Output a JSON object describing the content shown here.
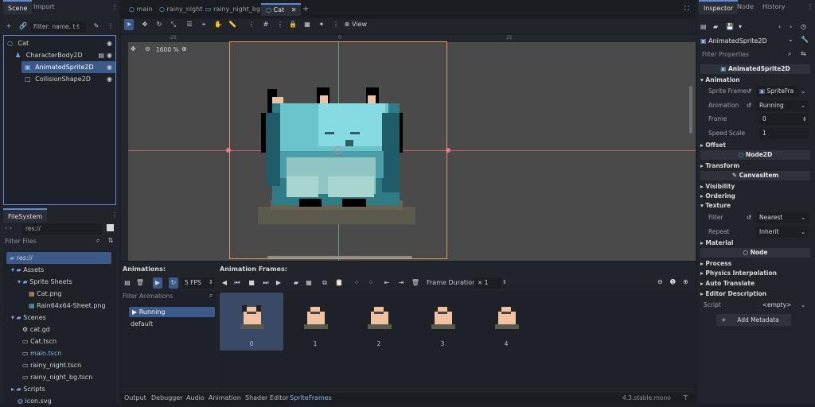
{
  "scene_dock": {
    "tabs": [
      "Scene",
      "Import"
    ],
    "filter_placeholder": "Filter: name, t:t",
    "tree": [
      {
        "label": "Cat",
        "icon": "node2d-icon"
      },
      {
        "label": "CharacterBody2D",
        "icon": "characterbody-icon"
      },
      {
        "label": "AnimatedSprite2D",
        "icon": "animatedsprite-icon",
        "selected": true
      },
      {
        "label": "CollisionShape2D",
        "icon": "collisionshape-icon"
      }
    ]
  },
  "filesystem": {
    "title": "FileSystem",
    "path": "res://",
    "filter_placeholder": "Filter Files",
    "items": [
      {
        "label": "res://"
      },
      {
        "label": "Assets"
      },
      {
        "label": "Sprite Sheets"
      },
      {
        "label": "Cat.png"
      },
      {
        "label": "Rain64x64-Sheet.png"
      },
      {
        "label": "Scenes"
      },
      {
        "label": "cat.gd"
      },
      {
        "label": "Cat.tscn"
      },
      {
        "label": "main.tscn"
      },
      {
        "label": "rainy_night.tscn"
      },
      {
        "label": "rainy_night_bg.tscn"
      },
      {
        "label": "Scripts"
      },
      {
        "label": "icon.svg"
      }
    ]
  },
  "editor_tabs": [
    "main",
    "rainy_night",
    "rainy_night_bg",
    "Cat"
  ],
  "toolbar": {
    "view_label": "View"
  },
  "viewport": {
    "zoom": "1600 %",
    "ruler_ticks": [
      "-25",
      "0",
      "25"
    ]
  },
  "animations_panel": {
    "title": "Animations:",
    "fps": "5 FPS",
    "filter_placeholder": "Filter Animations",
    "items": [
      "Running",
      "default"
    ],
    "selected": "Running"
  },
  "frames_panel": {
    "title": "Animation Frames:",
    "duration_label": "Frame Duration:",
    "duration_value": "1",
    "frames": [
      "0",
      "1",
      "2",
      "3",
      "4"
    ]
  },
  "bottom_tabs": [
    "Output",
    "Debugger",
    "Audio",
    "Animation",
    "Shader Editor",
    "SpriteFrames"
  ],
  "active_bottom_tab": "SpriteFrames",
  "version": "4.3.stable.mono",
  "inspector": {
    "tabs": [
      "Inspector",
      "Node",
      "History"
    ],
    "node": "AnimatedSprite2D",
    "filter_placeholder": "Filter Properties",
    "class_header": "AnimatedSprite2D",
    "sections": {
      "animation": "Animation",
      "offset": "Offset",
      "node2d": "Node2D",
      "transform": "Transform",
      "canvasitem": "CanvasItem",
      "visibility": "Visibility",
      "ordering": "Ordering",
      "texture": "Texture",
      "material": "Material",
      "node": "Node",
      "process": "Process",
      "physics": "Physics Interpolation",
      "autotranslate": "Auto Translate",
      "editordesc": "Editor Description"
    },
    "props": {
      "sprite_frames_label": "Sprite Frame",
      "sprite_frames_value": "SpriteFra",
      "animation_label": "Animation",
      "animation_value": "Running",
      "frame_label": "Frame",
      "frame_value": "0",
      "speed_label": "Speed Scale",
      "speed_value": "1",
      "filter_label": "Filter",
      "filter_value": "Nearest",
      "repeat_label": "Repeat",
      "repeat_value": "Inherit",
      "script_label": "Script",
      "script_value": "<empty>"
    },
    "add_metadata": "Add Metadata"
  },
  "colors": {
    "accent": "#5f8bd6",
    "selection": "#3b5a8a",
    "viewport": "#4a4a4a",
    "cat_teal": "#7fd3d8"
  }
}
